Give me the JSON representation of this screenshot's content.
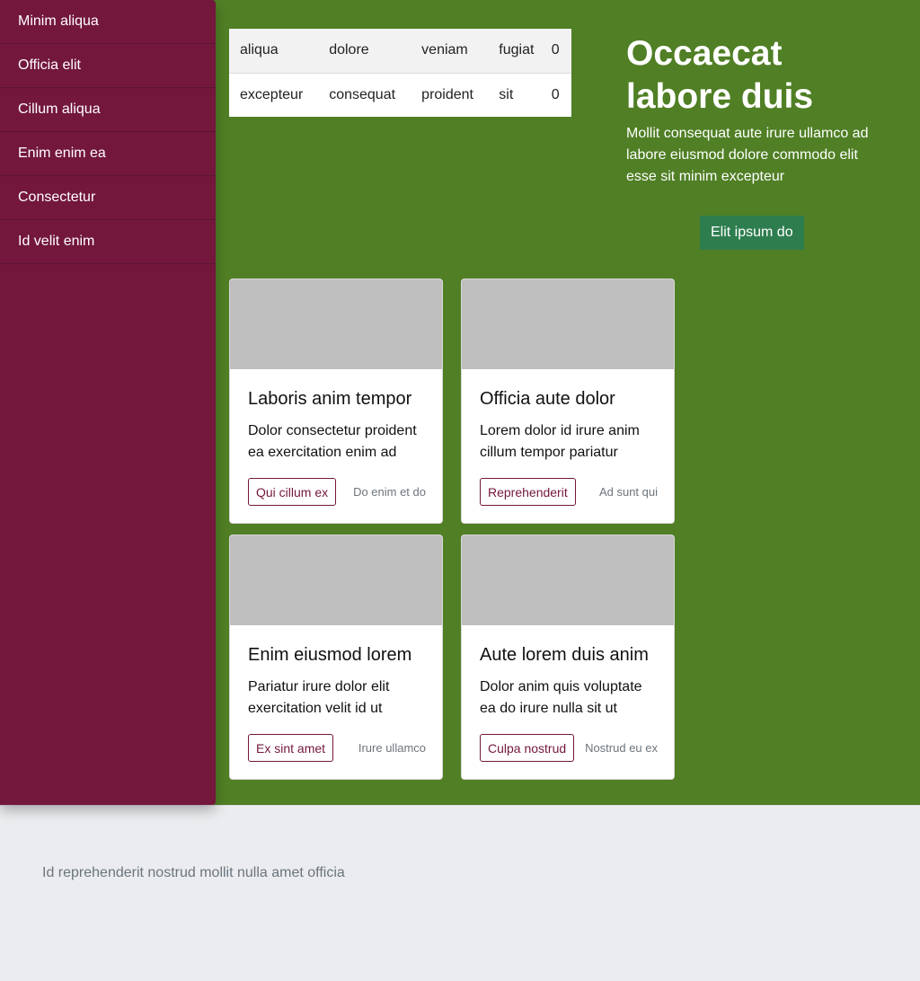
{
  "sidebar": {
    "items": [
      {
        "label": "Minim aliqua"
      },
      {
        "label": "Officia elit"
      },
      {
        "label": "Cillum aliqua"
      },
      {
        "label": "Enim enim ea"
      },
      {
        "label": "Consectetur"
      },
      {
        "label": "Id velit enim"
      }
    ]
  },
  "table": {
    "rows": [
      [
        "aliqua",
        "dolore",
        "veniam",
        "fugiat",
        "0"
      ],
      [
        "excepteur",
        "consequat",
        "proident",
        "sit",
        "0"
      ]
    ]
  },
  "hero": {
    "title": "Occaecat labore duis",
    "text": "Mollit consequat aute irure ullamco ad labore eiusmod dolore commodo elit esse sit minim excepteur",
    "button_label": "Elit ipsum do"
  },
  "cards": [
    {
      "title": "Laboris anim tempor",
      "text": "Dolor consectetur proident ea exercitation enim ad",
      "button_label": "Qui cillum ex",
      "link_label": "Do enim et do"
    },
    {
      "title": "Officia aute dolor",
      "text": "Lorem dolor id irure anim cillum tempor pariatur",
      "button_label": "Reprehenderit",
      "link_label": "Ad sunt qui"
    },
    {
      "title": "Enim eiusmod lorem",
      "text": "Pariatur irure dolor elit exercitation velit id ut",
      "button_label": "Ex sint amet",
      "link_label": "Irure ullamco"
    },
    {
      "title": "Aute lorem duis anim",
      "text": "Dolor anim quis voluptate ea do irure nulla sit ut",
      "button_label": "Culpa nostrud",
      "link_label": "Nostrud eu ex"
    }
  ],
  "footer": {
    "text": "Id reprehenderit nostrud mollit nulla amet officia"
  },
  "colors": {
    "main_background": "#507f25",
    "sidebar_background": "#73173d",
    "hero_button": "#2e7d4f",
    "card_image_placeholder": "#bebebe",
    "footer_background": "#eaecef"
  }
}
